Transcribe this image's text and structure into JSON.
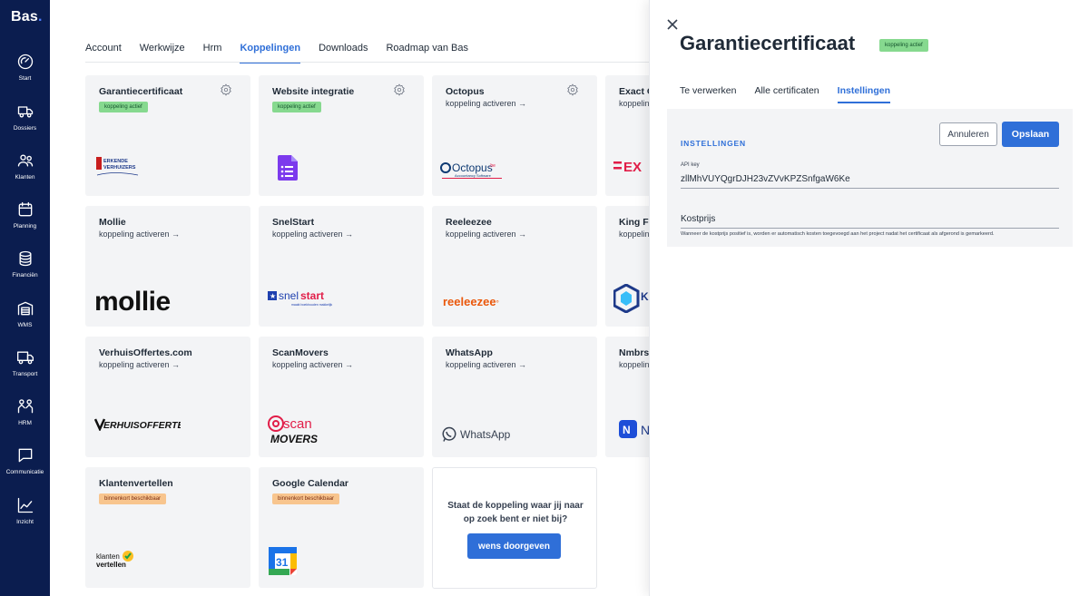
{
  "brand": "Bas",
  "nav": [
    {
      "label": "Start",
      "icon": "dashboard-icon"
    },
    {
      "label": "Dossiers",
      "icon": "truck-icon"
    },
    {
      "label": "Klanten",
      "icon": "users-icon"
    },
    {
      "label": "Planning",
      "icon": "calendar-icon"
    },
    {
      "label": "Financiën",
      "icon": "coins-icon"
    },
    {
      "label": "WMS",
      "icon": "warehouse-icon"
    },
    {
      "label": "Transport",
      "icon": "delivery-truck-icon"
    },
    {
      "label": "HRM",
      "icon": "team-icon"
    },
    {
      "label": "Communicatie",
      "icon": "chat-icon"
    },
    {
      "label": "Inzicht",
      "icon": "chart-icon"
    }
  ],
  "tabs": [
    "Account",
    "Werkwijze",
    "Hrm",
    "Koppelingen",
    "Downloads",
    "Roadmap van Bas"
  ],
  "active_tab": "Koppelingen",
  "cards": [
    {
      "title": "Garantiecertificaat",
      "badge": "koppeling actief",
      "logo": "ERKENDE VERHUIZERS"
    },
    {
      "title": "Website integratie",
      "badge": "koppeling actief",
      "logo": "forms-icon"
    },
    {
      "title": "Octopus",
      "sub": "koppeling activeren →",
      "logo": "Octopus"
    },
    {
      "title": "Exact O",
      "sub": "koppelin",
      "logo": "=EX"
    },
    {
      "title": "Mollie",
      "sub": "koppeling activeren →",
      "logo": "mollie"
    },
    {
      "title": "SnelStart",
      "sub": "koppeling activeren →",
      "logo": "snelstart"
    },
    {
      "title": "Reeleezee",
      "sub": "koppeling activeren →",
      "logo": "reeleezee"
    },
    {
      "title": "King Fi",
      "sub": "koppelin",
      "logo": "K"
    },
    {
      "title": "VerhuisOffertes.com",
      "sub": "koppeling activeren →",
      "logo": "VERHUISOFFERTES"
    },
    {
      "title": "ScanMovers",
      "sub": "koppeling activeren →",
      "logo": "scan MOVERS"
    },
    {
      "title": "WhatsApp",
      "sub": "koppeling activeren →",
      "logo": "WhatsApp"
    },
    {
      "title": "Nmbrs",
      "sub": "koppelin",
      "logo": "N"
    },
    {
      "title": "Klantenvertellen",
      "badge": "binnenkort beschikbaar",
      "logo": "klanten vertellen"
    },
    {
      "title": "Google Calendar",
      "badge": "binnenkort beschikbaar",
      "logo": "31"
    }
  ],
  "cta": {
    "text": "Staat de koppeling waar jij naar op zoek bent er niet bij?",
    "button": "wens doorgeven"
  },
  "drawer": {
    "title": "Garantiecertificaat",
    "badge": "koppeling actief",
    "tabs": [
      "Te verwerken",
      "Alle certificaten",
      "Instellingen"
    ],
    "active_tab": "Instellingen",
    "section_title": "INSTELLINGEN",
    "cancel": "Annuleren",
    "save": "Opslaan",
    "api_label": "API key",
    "api_value": "zllMhVUYQgrDJH23vZVvKPZSnfgaW6Ke",
    "kostprijs_label": "Kostprijs",
    "hint": "Wanneer de kostprijs positief is, worden er automatisch kosten toegevoegd aan het project nadat het certificaat als afgerond is gemarkeerd."
  },
  "colors": {
    "sidebar": "#0b1d4f",
    "accent": "#2f6fd8",
    "active_badge": "#86d98f",
    "soon_badge": "#f8c58e"
  }
}
